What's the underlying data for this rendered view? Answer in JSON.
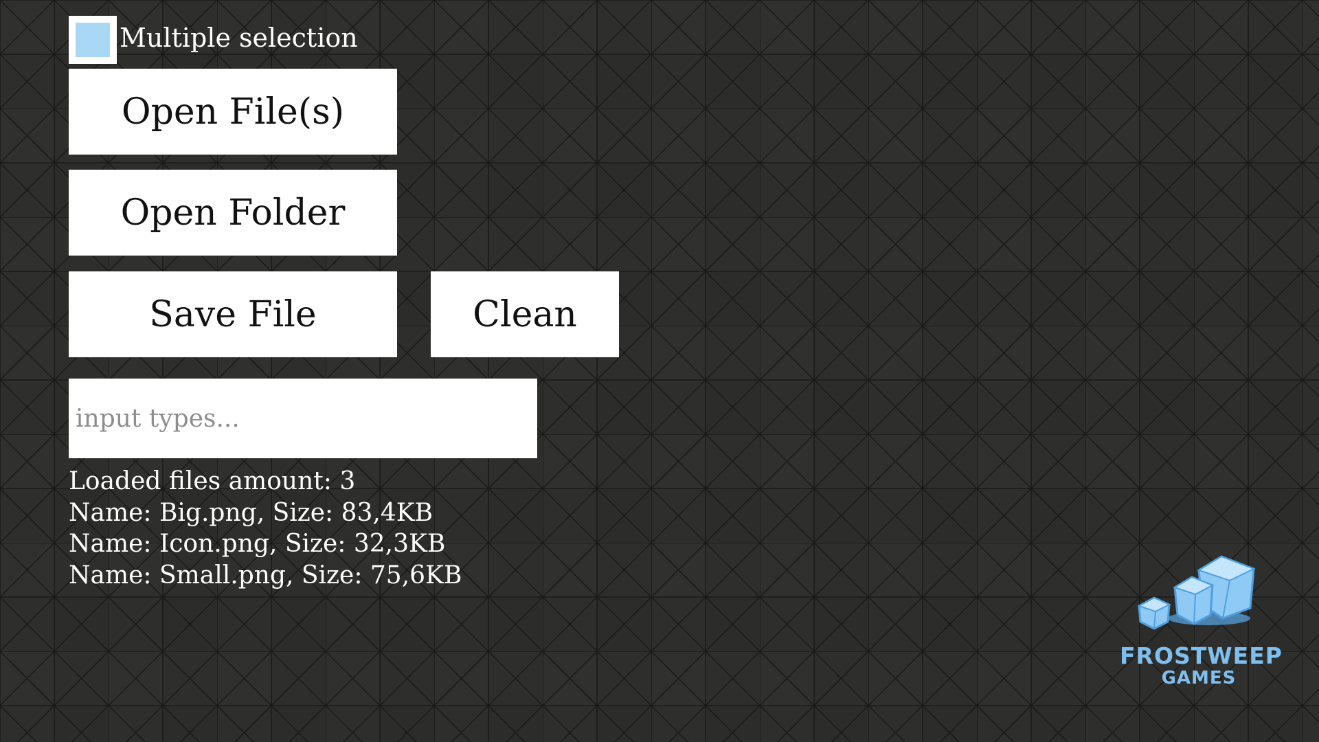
{
  "colors": {
    "background": "#2e2f2c",
    "grid_line": "#1b1c1a",
    "button_bg": "#ffffff",
    "checkbox_accent": "#a9d8f5",
    "logo_accent": "#7fbff0"
  },
  "multiple_selection": {
    "label": "Multiple selection",
    "checked": true
  },
  "buttons": {
    "open_files": "Open File(s)",
    "open_folder": "Open Folder",
    "save_file": "Save File",
    "clean": "Clean"
  },
  "input": {
    "value": "",
    "placeholder": "input types..."
  },
  "info": {
    "loaded_amount": "Loaded files amount: 3",
    "files": [
      "Name: Big.png, Size: 83,4KB",
      "Name: Icon.png, Size: 32,3KB",
      "Name: Small.png, Size: 75,6KB"
    ]
  },
  "logo": {
    "line1": "FROSTWEEP",
    "line2": "GAMES",
    "icon": "ice-cubes-icon"
  }
}
